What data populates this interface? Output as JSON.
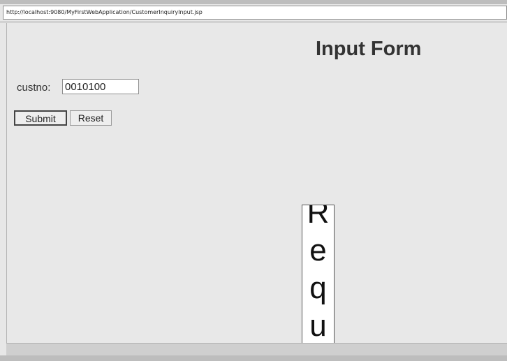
{
  "browser": {
    "address_url": "http://localhost:9080/MyFirstWebApplication/CustomerInquiryInput.jsp"
  },
  "form": {
    "title": "Input Form",
    "custno_label": "custno:",
    "custno_value": "0010100",
    "submit_label": "Submit",
    "reset_label": "Reset"
  },
  "overlay": {
    "vertical_text_chars": [
      "R",
      "e",
      "q",
      "u"
    ]
  }
}
